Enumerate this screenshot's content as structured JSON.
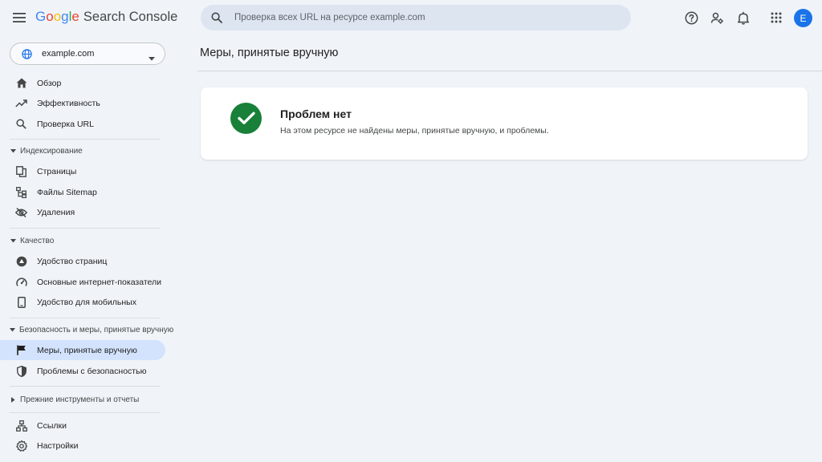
{
  "header": {
    "logo_letters": [
      {
        "ch": "G",
        "color": "#4285F4"
      },
      {
        "ch": "o",
        "color": "#EA4335"
      },
      {
        "ch": "o",
        "color": "#FBBC05"
      },
      {
        "ch": "g",
        "color": "#4285F4"
      },
      {
        "ch": "l",
        "color": "#34A853"
      },
      {
        "ch": "e",
        "color": "#EA4335"
      }
    ],
    "product_name": "Search Console",
    "search_placeholder": "Проверка всех URL на ресурсе example.com",
    "avatar_letter": "E",
    "icons": [
      "help-icon",
      "manage-users-icon",
      "notifications-icon",
      "apps-grid-icon"
    ]
  },
  "sidebar": {
    "property": "example.com",
    "items_top": [
      {
        "label": "Обзор",
        "icon": "home-icon"
      },
      {
        "label": "Эффективность",
        "icon": "trending-icon"
      },
      {
        "label": "Проверка URL",
        "icon": "search-icon"
      }
    ],
    "indexing": {
      "title": "Индексирование",
      "items": [
        {
          "label": "Страницы",
          "icon": "pages-icon"
        },
        {
          "label": "Файлы Sitemap",
          "icon": "sitemap-icon"
        },
        {
          "label": "Удаления",
          "icon": "removals-icon"
        }
      ]
    },
    "quality": {
      "title": "Качество",
      "items": [
        {
          "label": "Удобство страниц",
          "icon": "page-experience-icon"
        },
        {
          "label": "Основные интернет-показатели",
          "icon": "gauge-icon"
        },
        {
          "label": "Удобство для мобильных",
          "icon": "mobile-icon"
        }
      ]
    },
    "security": {
      "title": "Безопасность и меры, принятые вручную",
      "items": [
        {
          "label": "Меры, принятые вручную",
          "icon": "flag-icon",
          "active": true
        },
        {
          "label": "Проблемы с безопасностью",
          "icon": "shield-icon"
        }
      ]
    },
    "legacy": {
      "title": "Прежние инструменты и отчеты"
    },
    "items_bottom": [
      {
        "label": "Ссылки",
        "icon": "links-icon"
      },
      {
        "label": "Настройки",
        "icon": "settings-icon"
      }
    ]
  },
  "main": {
    "page_title": "Меры, принятые вручную",
    "card": {
      "title": "Проблем нет",
      "description": "На этом ресурсе не найдены меры, принятые вручную, и проблемы."
    }
  },
  "colors": {
    "background": "#f0f4f9",
    "active_nav": "#d3e3fd",
    "success": "#188038",
    "avatar": "#1a73e8"
  }
}
